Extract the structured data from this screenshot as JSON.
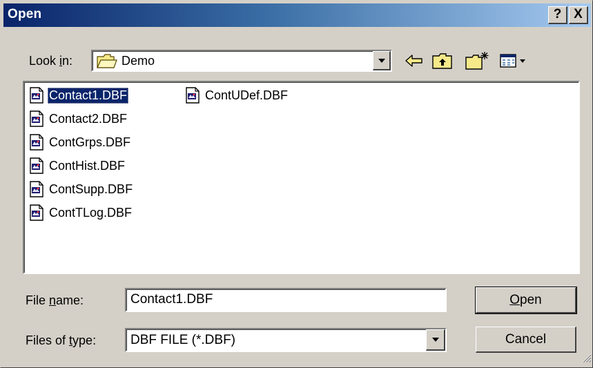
{
  "window": {
    "title": "Open"
  },
  "caption_buttons": {
    "help": "?",
    "close": "X"
  },
  "lookin": {
    "prefix": "Look ",
    "hotkey": "i",
    "suffix": "n:",
    "value": "Demo"
  },
  "toolbar": {
    "icons": [
      "back-arrow-icon",
      "up-folder-icon",
      "new-folder-icon",
      "view-menu-icon"
    ]
  },
  "files": [
    {
      "name": "Contact1.DBF",
      "selected": true
    },
    {
      "name": "Contact2.DBF",
      "selected": false
    },
    {
      "name": "ContGrps.DBF",
      "selected": false
    },
    {
      "name": "ContHist.DBF",
      "selected": false
    },
    {
      "name": "ContSupp.DBF",
      "selected": false
    },
    {
      "name": "ContTLog.DBF",
      "selected": false
    },
    {
      "name": "ContUDef.DBF",
      "selected": false
    }
  ],
  "filename": {
    "prefix": "File ",
    "hotkey": "n",
    "suffix": "ame:",
    "value": "Contact1.DBF"
  },
  "filetype": {
    "prefix": "Files of ",
    "hotkey": "t",
    "suffix": "ype:",
    "value": "DBF FILE (*.DBF)"
  },
  "buttons": {
    "open": {
      "hotkey": "O",
      "rest": "pen"
    },
    "cancel": "Cancel"
  }
}
